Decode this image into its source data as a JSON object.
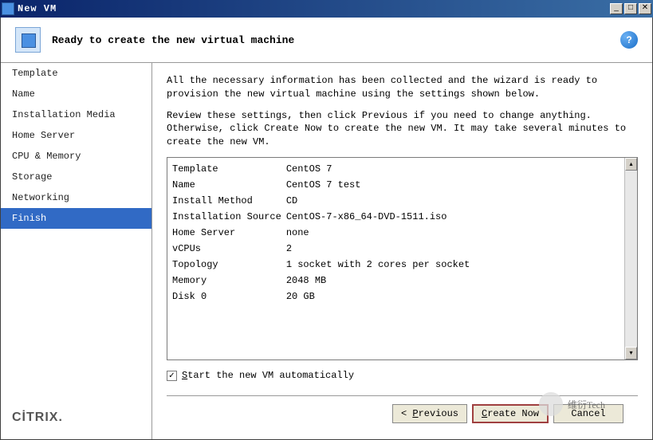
{
  "window": {
    "title": "New VM"
  },
  "header": {
    "title": "Ready to create the new virtual machine"
  },
  "sidebar": {
    "items": [
      {
        "label": "Template",
        "selected": false
      },
      {
        "label": "Name",
        "selected": false
      },
      {
        "label": "Installation Media",
        "selected": false
      },
      {
        "label": "Home Server",
        "selected": false
      },
      {
        "label": "CPU & Memory",
        "selected": false
      },
      {
        "label": "Storage",
        "selected": false
      },
      {
        "label": "Networking",
        "selected": false
      },
      {
        "label": "Finish",
        "selected": true
      }
    ],
    "brand": "CİTRIX"
  },
  "content": {
    "desc1": "All the necessary information has been collected and the wizard is ready to provision the new virtual machine using the settings shown below.",
    "desc2": "Review these settings, then click Previous if you need to change anything. Otherwise, click Create Now to create the new VM. It may take several minutes to create the new VM.",
    "summary": [
      {
        "label": "Template",
        "value": "CentOS 7"
      },
      {
        "label": "Name",
        "value": "CentOS 7 test"
      },
      {
        "label": "Install Method",
        "value": "CD"
      },
      {
        "label": "Installation Source",
        "value": "CentOS-7-x86_64-DVD-1511.iso"
      },
      {
        "label": "Home Server",
        "value": "none"
      },
      {
        "label": "vCPUs",
        "value": "2"
      },
      {
        "label": "Topology",
        "value": "1 socket with 2 cores per socket"
      },
      {
        "label": "Memory",
        "value": "2048 MB"
      },
      {
        "label": "Disk 0",
        "value": "20 GB"
      }
    ],
    "checkbox_label_pre": "S",
    "checkbox_label_rest": "tart the new VM automatically",
    "checkbox_checked": true
  },
  "buttons": {
    "previous": "Previous",
    "create": "Create Now",
    "cancel": "Cancel"
  },
  "watermark": "维衍Tech"
}
